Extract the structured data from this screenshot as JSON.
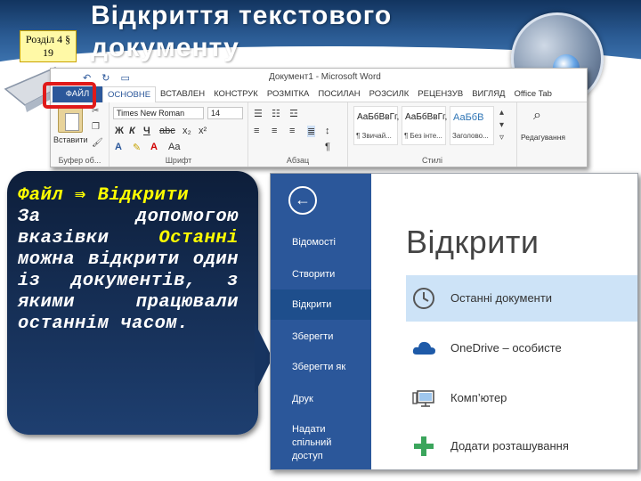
{
  "slide": {
    "title": "Відкриття текстового документу",
    "section_badge": [
      "Розділ 4 §",
      "19"
    ]
  },
  "ribbon": {
    "window_title": "Документ1 - Microsoft Word",
    "tabs": [
      "ФАЙЛ",
      "ОСНОВНЕ",
      "ВСТАВЛЕН",
      "КОНСТРУК",
      "РОЗМІТКА",
      "ПОСИЛАН",
      "РОЗСИЛК",
      "РЕЦЕНЗУВ",
      "ВИГЛЯД",
      "Office Tab"
    ],
    "paste_label": "Вставити",
    "font_name": "Times New Roman",
    "font_size": "14",
    "style_samples": [
      {
        "sample": "АаБбВвГг,",
        "name": "¶ Звичай..."
      },
      {
        "sample": "АаБбВвГг,",
        "name": "¶ Без інте..."
      },
      {
        "sample": "АаБбВ",
        "name": "Заголово..."
      }
    ],
    "edit_label": "Редагування",
    "groups": {
      "clipboard": "Буфер об...",
      "font": "Шрифт",
      "paragraph": "Абзац",
      "styles": "Стилі"
    }
  },
  "callout": {
    "line1": "Файл ⇛ Відкрити",
    "text_before": "За допомогою вказівки ",
    "highlight": "Останні",
    "text_after": " можна відкрити один із документів, з якими працювали останнім часом."
  },
  "backstage": {
    "back_symbol": "←",
    "nav": [
      "Відомості",
      "Створити",
      "Відкрити",
      "Зберегти",
      "Зберегти як",
      "Друк",
      "Надати спільний доступ"
    ],
    "active_nav": "Відкрити",
    "title": "Відкрити",
    "places": [
      {
        "label": "Останні документи",
        "icon": "clock-icon"
      },
      {
        "label": "OneDrive – особисте",
        "icon": "cloud-icon"
      },
      {
        "label": "Комп’ютер",
        "icon": "computer-icon"
      },
      {
        "label": "Додати розташування",
        "icon": "plus-icon"
      }
    ]
  },
  "colors": {
    "word_blue": "#2b579a",
    "highlight_red": "#e01a1a",
    "callout_yellow": "#ffff00"
  }
}
